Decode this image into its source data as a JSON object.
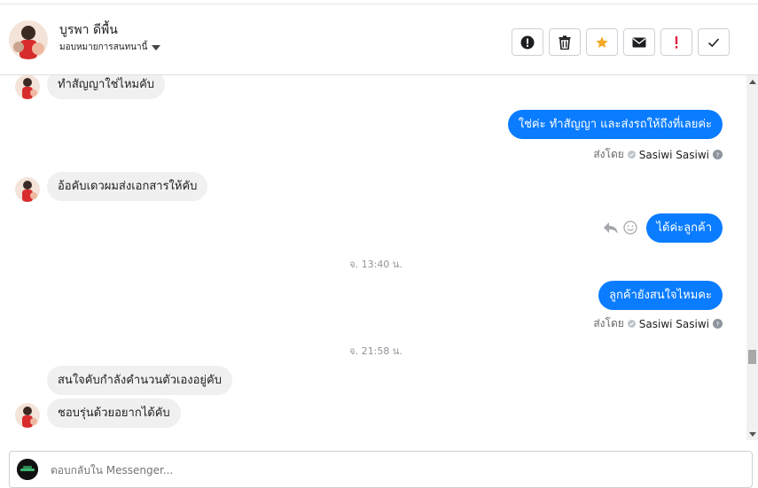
{
  "header": {
    "contact_name": "บูรพา ดีพื้น",
    "assign_label": "มอบหมายการสนทนานี้"
  },
  "toolbar": {
    "icons": [
      "alert-circle-icon",
      "trash-icon",
      "star-icon",
      "envelope-icon",
      "exclamation-icon",
      "check-icon"
    ]
  },
  "messages": [
    {
      "dir": "in",
      "text": "ทำสัญญาใช่ไหมคับ"
    },
    {
      "dir": "out",
      "text": "ใช่ค่ะ ทำสัญญา และส่งรถให้ถึงที่เลยค่ะ"
    },
    {
      "dir": "meta",
      "label": "ส่งโดย",
      "sender": "Sasiwi Sasiwi"
    },
    {
      "dir": "in",
      "text": "อ้อคับเดวผมส่งเอกสารให้คับ"
    },
    {
      "dir": "out",
      "text": "ได้ค่ะลูกค้า"
    },
    {
      "dir": "time",
      "text": "จ. 13:40 น."
    },
    {
      "dir": "out",
      "text": "ลูกค้ายังสนใจไหมคะ"
    },
    {
      "dir": "meta",
      "label": "ส่งโดย",
      "sender": "Sasiwi Sasiwi"
    },
    {
      "dir": "time",
      "text": "จ. 21:58 น."
    },
    {
      "dir": "in",
      "text": "สนใจคับกำลังคำนวนตัวเองอยู่คับ"
    },
    {
      "dir": "in",
      "text": "ชอบรุ่นด้วยอยากได้คับ"
    }
  ],
  "composer": {
    "placeholder": "ตอบกลับใน Messenger..."
  },
  "colors": {
    "outgoing_bubble": "#0a7cff",
    "incoming_bubble": "#f0f0f0",
    "star": "#f5a623",
    "exclamation": "#e41e3f"
  }
}
